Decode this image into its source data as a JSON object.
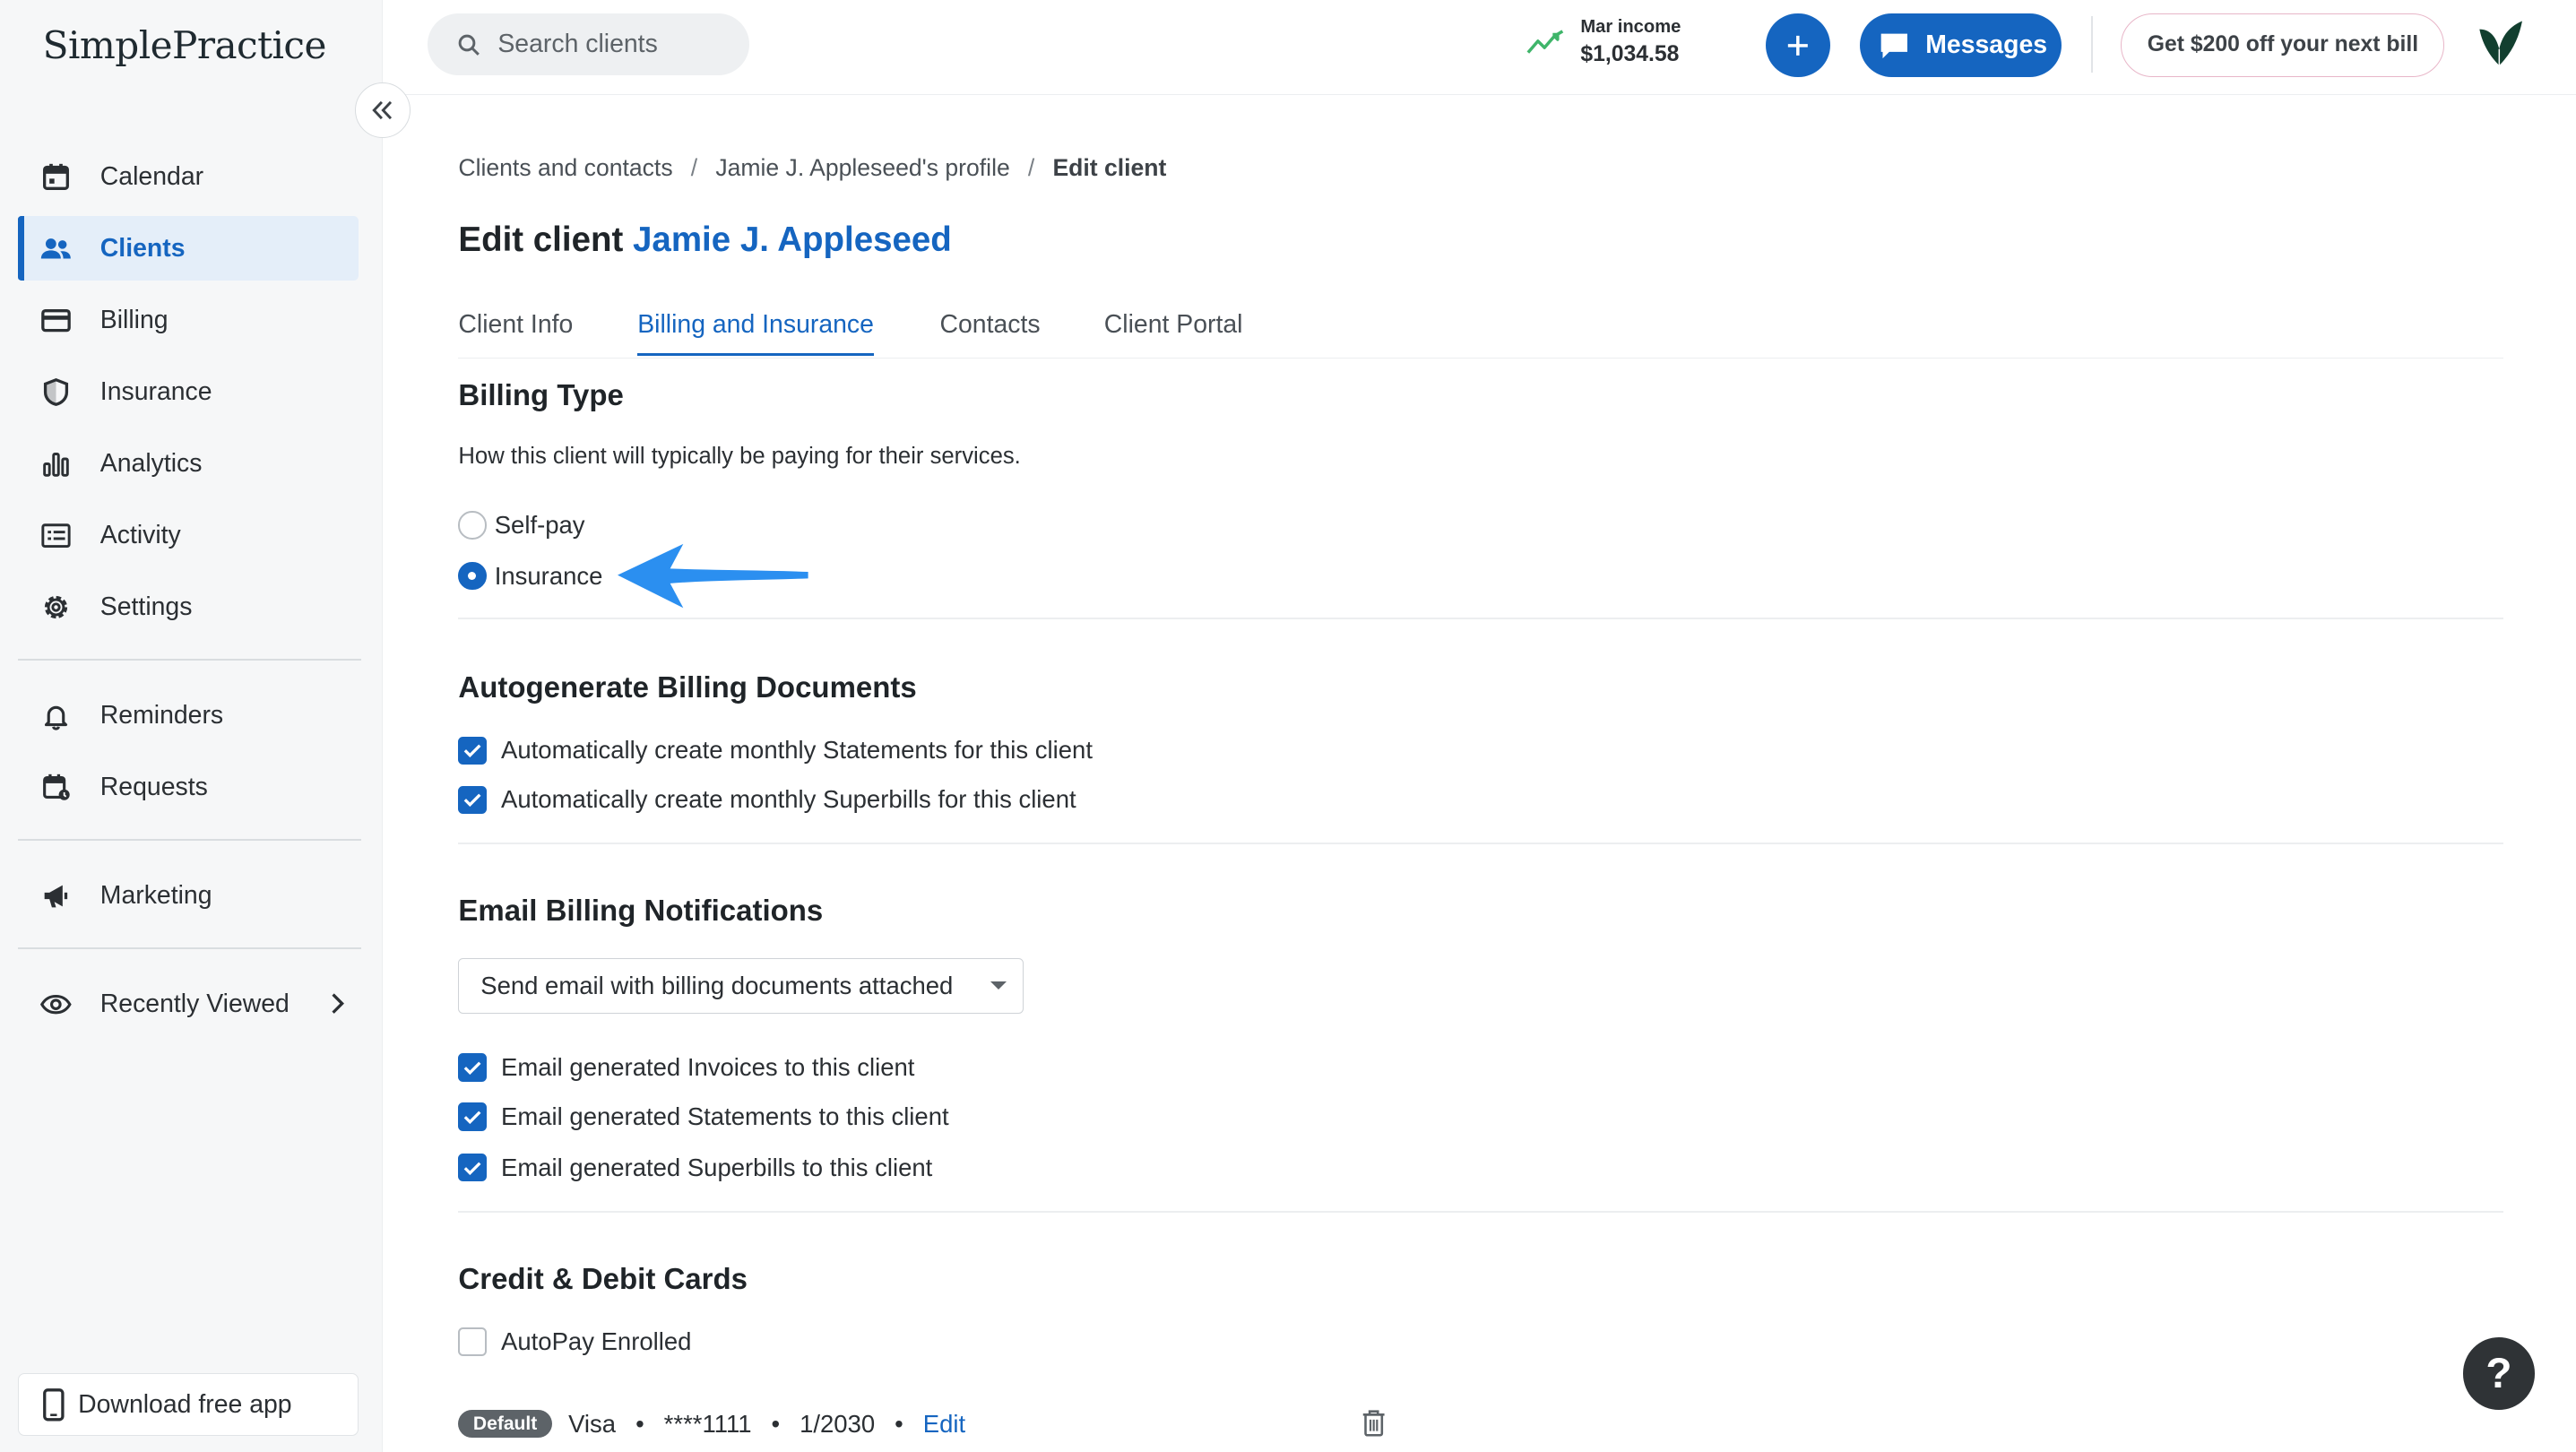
{
  "brand": {
    "logo_text": "SimplePractice"
  },
  "sidebar": {
    "items": [
      {
        "label": "Calendar",
        "icon": "calendar-icon"
      },
      {
        "label": "Clients",
        "icon": "users-icon",
        "active": true
      },
      {
        "label": "Billing",
        "icon": "credit-card-icon"
      },
      {
        "label": "Insurance",
        "icon": "shield-icon"
      },
      {
        "label": "Analytics",
        "icon": "bar-chart-icon"
      },
      {
        "label": "Activity",
        "icon": "list-icon"
      },
      {
        "label": "Settings",
        "icon": "gear-icon"
      }
    ],
    "secondary": [
      {
        "label": "Reminders",
        "icon": "bell-icon"
      },
      {
        "label": "Requests",
        "icon": "calendar-request-icon"
      }
    ],
    "tertiary": [
      {
        "label": "Marketing",
        "icon": "megaphone-icon"
      }
    ],
    "recently_viewed": {
      "label": "Recently Viewed",
      "icon": "eye-icon"
    },
    "download_label": "Download free app"
  },
  "header": {
    "search_placeholder": "Search clients",
    "income_label": "Mar income",
    "income_value": "$1,034.58",
    "messages_label": "Messages",
    "promo_label": "Get $200 off your next bill"
  },
  "breadcrumb": {
    "items": [
      "Clients and contacts",
      "Jamie J. Appleseed's profile",
      "Edit client"
    ],
    "separator": "/"
  },
  "page": {
    "title_prefix": "Edit client",
    "client_name": "Jamie J. Appleseed"
  },
  "tabs": [
    {
      "label": "Client Info"
    },
    {
      "label": "Billing and Insurance",
      "active": true
    },
    {
      "label": "Contacts"
    },
    {
      "label": "Client Portal"
    }
  ],
  "billing_type": {
    "title": "Billing Type",
    "description": "How this client will typically be paying for their services.",
    "options": [
      {
        "label": "Self-pay",
        "selected": false
      },
      {
        "label": "Insurance",
        "selected": true
      }
    ]
  },
  "autogenerate": {
    "title": "Autogenerate Billing Documents",
    "options": [
      {
        "label": "Automatically create monthly Statements for this client",
        "checked": true
      },
      {
        "label": "Automatically create monthly Superbills for this client",
        "checked": true
      }
    ]
  },
  "email_notifications": {
    "title": "Email Billing Notifications",
    "select_value": "Send email with billing documents attached",
    "options": [
      {
        "label": "Email generated Invoices to this client",
        "checked": true
      },
      {
        "label": "Email generated Statements to this client",
        "checked": true
      },
      {
        "label": "Email generated Superbills to this client",
        "checked": true
      }
    ]
  },
  "cards": {
    "title": "Credit & Debit Cards",
    "autopay_label": "AutoPay Enrolled",
    "autopay_checked": false,
    "card": {
      "badge": "Default",
      "brand": "Visa",
      "number": "****1111",
      "expiry": "1/2030",
      "edit_label": "Edit",
      "separator": "•"
    }
  },
  "help_label": "?",
  "colors": {
    "accent": "#1565c0",
    "arrow": "#2b8ff0"
  }
}
